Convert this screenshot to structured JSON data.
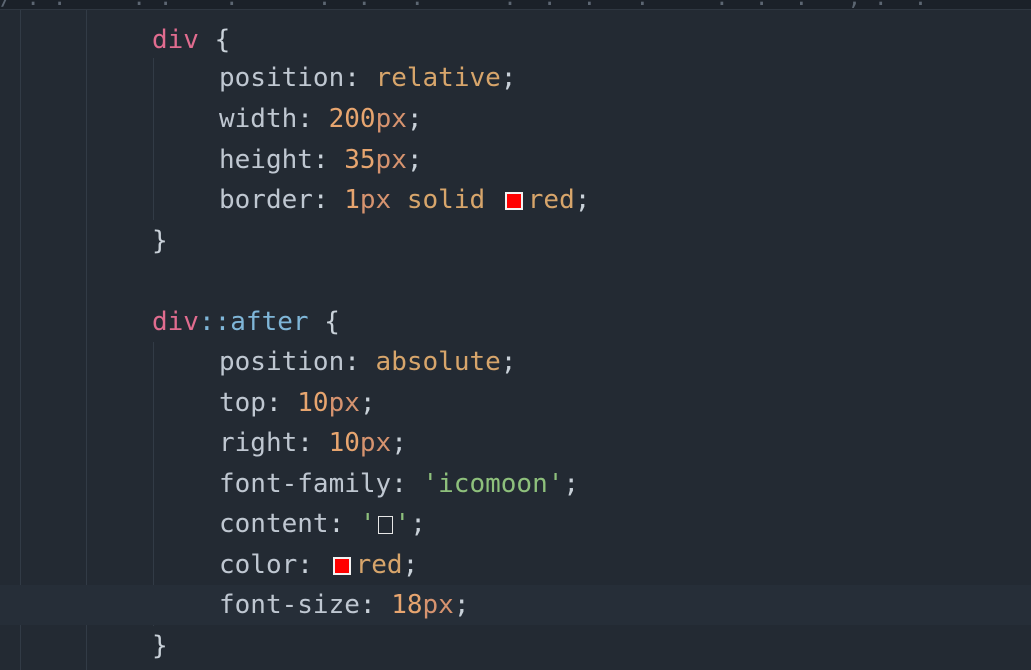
{
  "editor": {
    "header_text": "/ . .     . .    .      .  .   .      .  .  .   .     .  .  .   , .  .",
    "lines": [
      {
        "selector": "div",
        "brace": " {"
      },
      {
        "property": "position",
        "separator": ": ",
        "value": "relative",
        "end": ";"
      },
      {
        "property": "width",
        "separator": ": ",
        "number": "200",
        "unit": "px",
        "end": ";"
      },
      {
        "property": "height",
        "separator": ": ",
        "number": "35",
        "unit": "px",
        "end": ";"
      },
      {
        "property": "border",
        "separator": ": ",
        "number": "1",
        "unit": "px",
        "value": " solid ",
        "color_value": "red",
        "swatch_color": "#ff0000",
        "end": ";"
      },
      {
        "brace": "}"
      },
      {
        "selector": "div",
        "pseudo": "::after",
        "brace": " {"
      },
      {
        "property": "position",
        "separator": ": ",
        "value": "absolute",
        "end": ";"
      },
      {
        "property": "top",
        "separator": ": ",
        "number": "10",
        "unit": "px",
        "end": ";"
      },
      {
        "property": "right",
        "separator": ": ",
        "number": "10",
        "unit": "px",
        "end": ";"
      },
      {
        "property": "font-family",
        "separator": ": ",
        "string": "'icomoon'",
        "end": ";"
      },
      {
        "property": "content",
        "separator": ": ",
        "string_open": "'",
        "string_close": "'",
        "glyph": "missing-glyph-box",
        "end": ";"
      },
      {
        "property": "color",
        "separator": ": ",
        "color_value": "red",
        "swatch_color": "#ff0000",
        "end": ";"
      },
      {
        "property": "font-size",
        "separator": ": ",
        "number": "18",
        "unit": "px",
        "end": ";"
      },
      {
        "brace": "}"
      }
    ]
  }
}
